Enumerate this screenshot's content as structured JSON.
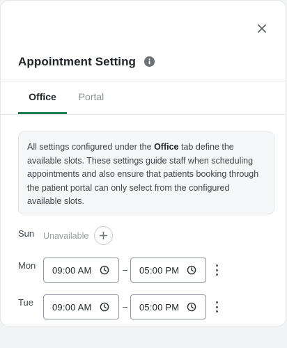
{
  "header": {
    "title": "Appointment Setting"
  },
  "tabs": [
    {
      "label": "Office",
      "active": true
    },
    {
      "label": "Portal",
      "active": false
    }
  ],
  "note": {
    "text_before": "All settings configured under the ",
    "bold_word": "Office",
    "text_after": " tab define the available slots. These settings guide staff when scheduling appointments and also ensure that patients booking through the patient portal can only select from the configured available slots."
  },
  "schedule": {
    "sun": {
      "day": "Sun",
      "status": "Unavailable"
    },
    "mon": {
      "day": "Mon",
      "start": "09:00 AM",
      "end": "05:00 PM"
    },
    "tue": {
      "day": "Tue",
      "start": "09:00 AM",
      "end": "05:00 PM"
    }
  },
  "icons": {
    "close": "close-icon",
    "info": "info-icon",
    "add": "plus-icon",
    "clock": "clock-icon",
    "more": "more-vertical-icon"
  },
  "colors": {
    "accent": "#1e7e4f",
    "note_bg": "#f6f7f9"
  }
}
